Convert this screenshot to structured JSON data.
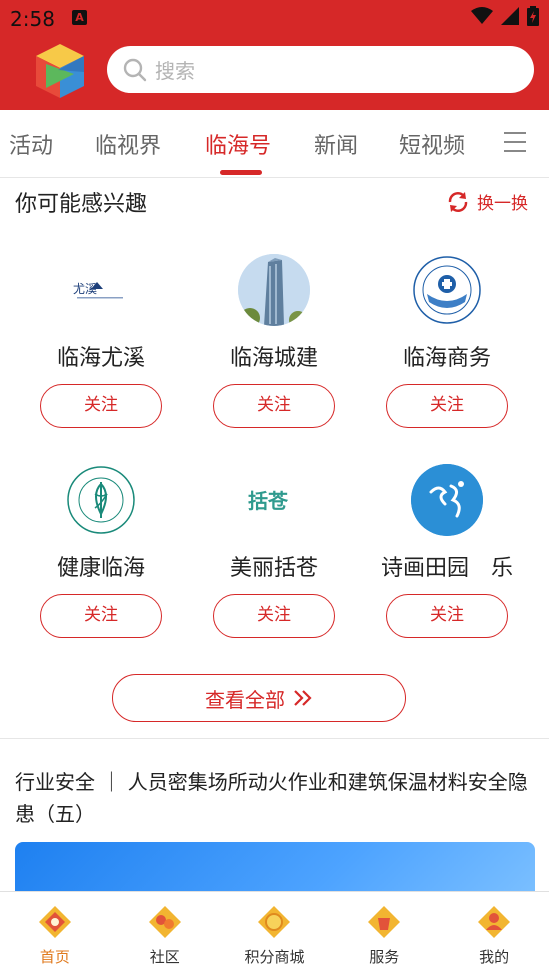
{
  "status_bar": {
    "time": "2:58",
    "badge": "A"
  },
  "search": {
    "placeholder": "搜索"
  },
  "tabs": [
    {
      "label": "活动",
      "active": false
    },
    {
      "label": "临视界",
      "active": false
    },
    {
      "label": "临海号",
      "active": true
    },
    {
      "label": "新闻",
      "active": false
    },
    {
      "label": "短视频",
      "active": false
    }
  ],
  "interest": {
    "title": "你可能感兴趣",
    "refresh_label": "换一换",
    "logo_text": {
      "youxi": "尤溪",
      "kuocang": "括苍"
    },
    "accounts": [
      {
        "name": "临海尤溪",
        "follow": "关注"
      },
      {
        "name": "临海城建",
        "follow": "关注"
      },
      {
        "name": "临海商务",
        "follow": "关注"
      },
      {
        "name": "健康临海",
        "follow": "关注"
      },
      {
        "name": "美丽括苍",
        "follow": "关注"
      },
      {
        "name": "诗画田园　乐",
        "follow": "关注"
      }
    ],
    "view_all": "查看全部"
  },
  "news": {
    "title": "行业安全 ｜ 人员密集场所动火作业和建筑保温材料安全隐患（五）"
  },
  "bottom_nav": [
    {
      "label": "首页",
      "active": true
    },
    {
      "label": "社区",
      "active": false
    },
    {
      "label": "积分商城",
      "active": false
    },
    {
      "label": "服务",
      "active": false
    },
    {
      "label": "我的",
      "active": false
    }
  ],
  "colors": {
    "brand_red": "#d62828",
    "nav_active": "#e07a1e"
  }
}
